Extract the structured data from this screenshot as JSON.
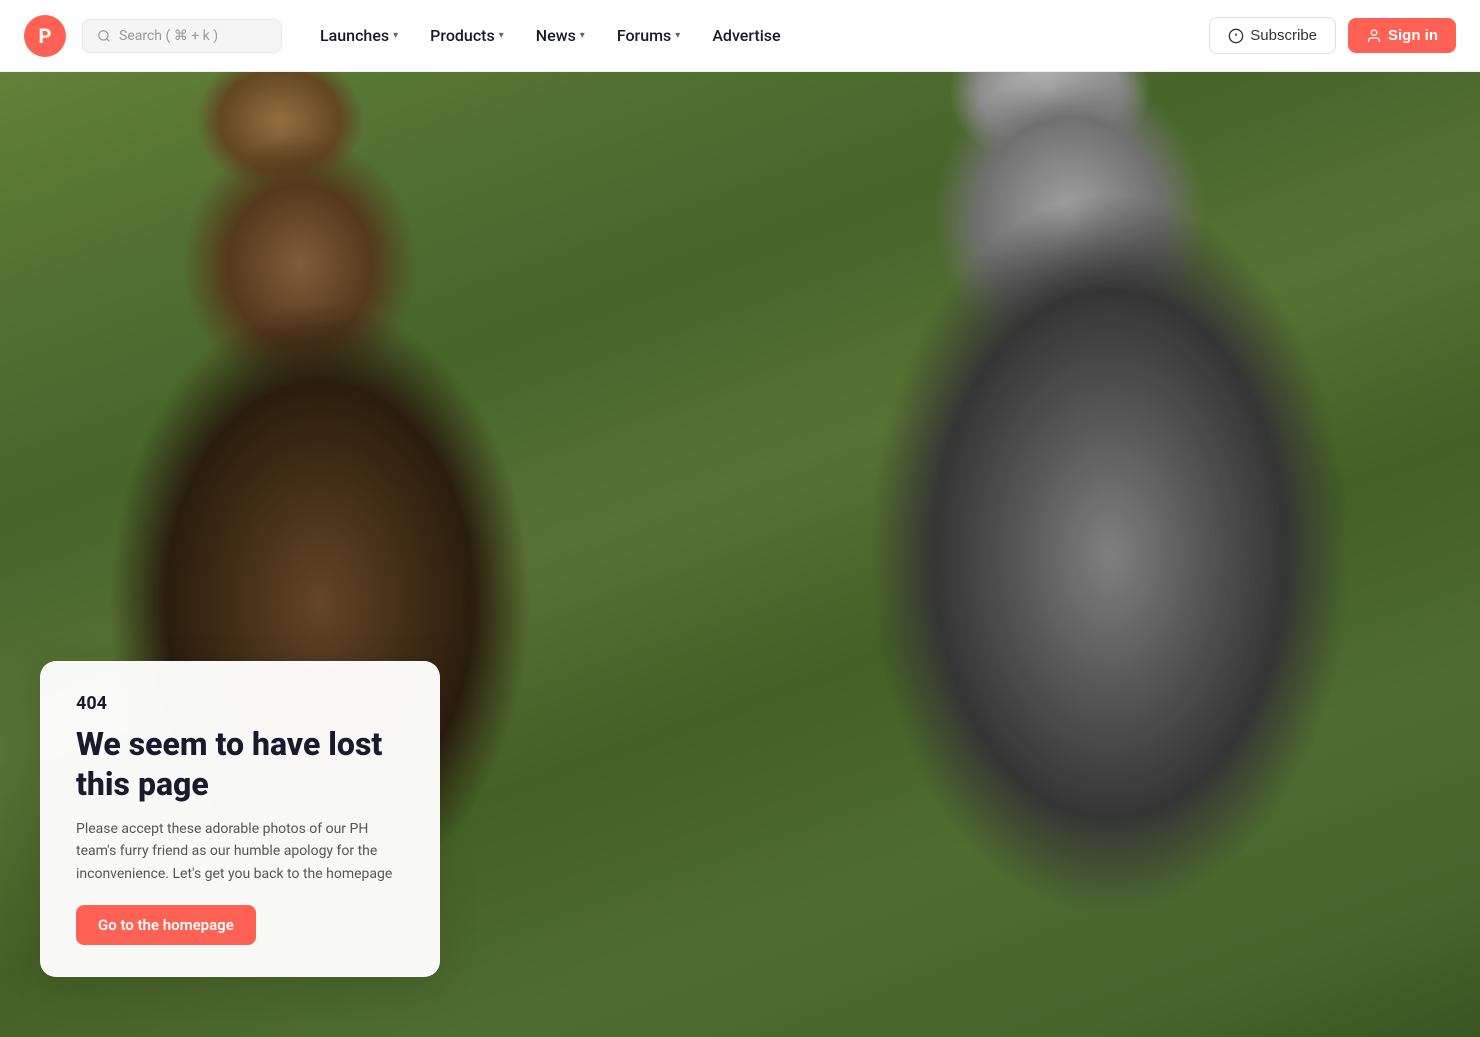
{
  "logo": {
    "letter": "P",
    "alt": "Product Hunt"
  },
  "search": {
    "placeholder": "Search ( ⌘ + k )"
  },
  "nav": {
    "items": [
      {
        "id": "launches",
        "label": "Launches",
        "hasDropdown": true
      },
      {
        "id": "products",
        "label": "Products",
        "hasDropdown": true
      },
      {
        "id": "news",
        "label": "News",
        "hasDropdown": true
      },
      {
        "id": "forums",
        "label": "Forums",
        "hasDropdown": true
      },
      {
        "id": "advertise",
        "label": "Advertise",
        "hasDropdown": false
      }
    ]
  },
  "actions": {
    "subscribe_label": "Subscribe",
    "signin_label": "Sign in"
  },
  "error": {
    "code": "404",
    "title": "We seem to have lost this page",
    "description": "Please accept these adorable photos of our PH team's furry friend as our humble apology for the inconvenience. Let's get you back to the homepage",
    "cta_label": "Go to the homepage"
  }
}
